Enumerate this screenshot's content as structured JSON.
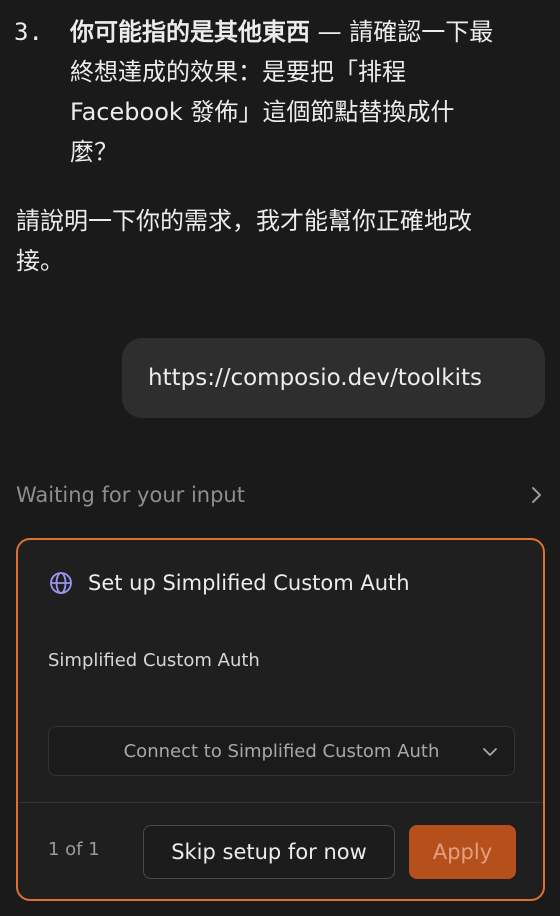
{
  "message": {
    "list_item": {
      "number": "3.",
      "bold": "你可能指的是其他東西",
      "rest": " — 請確認一下最終想達成的效果：是要把「排程 Facebook 發佈」這個節點替換成什麼？"
    },
    "closing": "請說明一下你的需求，我才能幫你正確地改接。"
  },
  "user_message": "https://composio.dev/toolkits",
  "status": {
    "waiting_label": "Waiting for your input",
    "icon": "chevron-right-icon"
  },
  "auth_card": {
    "icon": "globe-icon",
    "title": "Set up Simplified Custom Auth",
    "field_label": "Simplified Custom Auth",
    "select_value": "Connect to Simplified Custom Auth",
    "counter": "1 of 1",
    "skip_label": "Skip setup for now",
    "apply_label": "Apply"
  },
  "colors": {
    "background": "#1a1a1a",
    "accent": "#e0702f",
    "apply_button": "#b5501c",
    "globe_icon": "#9a96f0"
  }
}
